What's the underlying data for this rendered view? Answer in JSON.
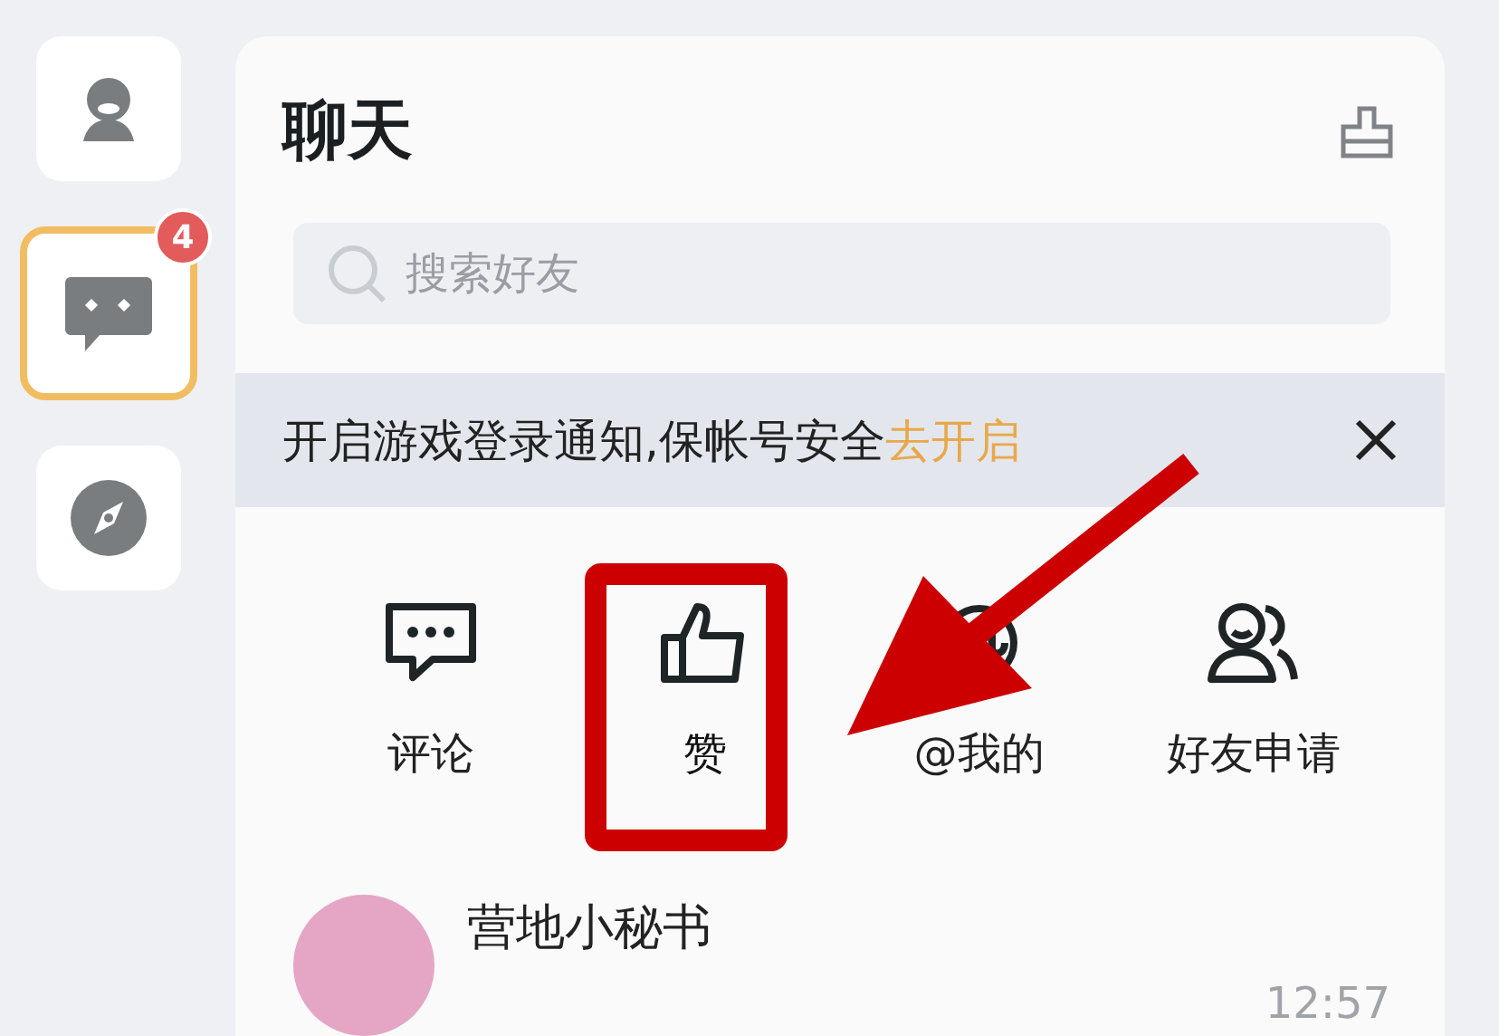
{
  "rail": [
    {
      "kind": "profile",
      "selected": false
    },
    {
      "kind": "chat",
      "selected": true,
      "badge": "4"
    },
    {
      "kind": "discover",
      "selected": false
    }
  ],
  "panel": {
    "title": "聊天"
  },
  "search": {
    "placeholder": "搜索好友"
  },
  "banner": {
    "text": "开启游戏登录通知,保帐号安全",
    "link": "去开启"
  },
  "shortcuts": [
    {
      "kind": "comment",
      "label": "评论",
      "highlighted": false
    },
    {
      "kind": "like",
      "label": "赞",
      "highlighted": true
    },
    {
      "kind": "mention",
      "label": "@我的",
      "highlighted": false
    },
    {
      "kind": "friends",
      "label": "好友申请",
      "highlighted": false
    }
  ],
  "chats": [
    {
      "name": "营地小秘书",
      "time": "12:57"
    }
  ]
}
